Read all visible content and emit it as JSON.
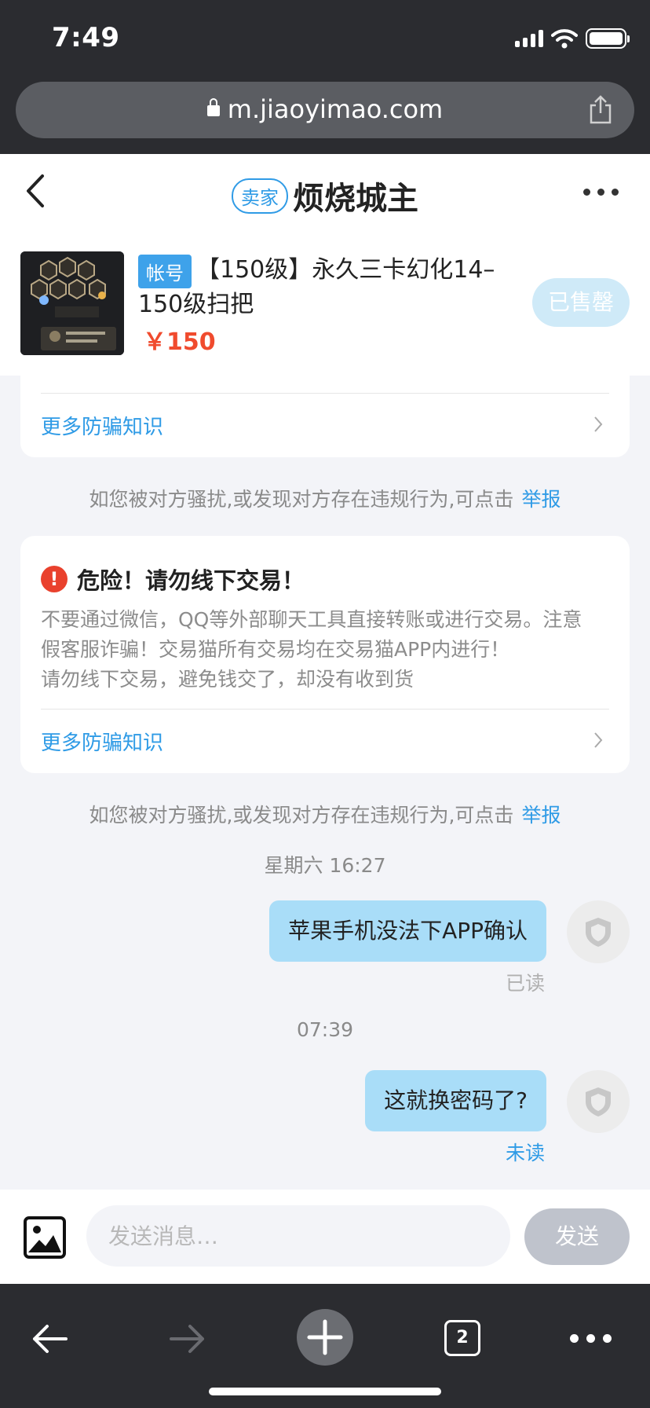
{
  "status": {
    "time": "7:49"
  },
  "browser": {
    "url": "m.jiaoyimao.com",
    "tab_count": "2"
  },
  "header": {
    "seller_badge": "卖家",
    "seller_name": "烦烧城主"
  },
  "product": {
    "tag": "帐号",
    "title": "【150级】永久三卡幻化14–150级扫把",
    "price": "￥150",
    "sold_label": "已售罄"
  },
  "notices": {
    "more_tips_link": "更多防骗知识",
    "report_prefix": "如您被对方骚扰,或发现对方存在违规行为,可点击",
    "report_link": "举报",
    "warning_title": "危险！请勿线下交易！",
    "warning_lines": [
      "不要通过微信，QQ等外部聊天工具直接转账或进行交易。注意",
      "假客服诈骗！交易猫所有交易均在交易猫APP内进行！",
      "请勿线下交易，避免钱交了，却没有收到货"
    ]
  },
  "messages": [
    {
      "time": "星期六 16:27",
      "text": "苹果手机没法下APP确认",
      "state": "已读",
      "state_color": "#b0b0b0"
    },
    {
      "time": "07:39",
      "text": "这就换密码了?",
      "state": "未读",
      "state_color": "#2f9be6"
    }
  ],
  "composer": {
    "placeholder": "发送消息…",
    "send_label": "发送"
  },
  "colors": {
    "accent": "#2f9be6",
    "bubble": "#a9ddf8",
    "price": "#f04b2e",
    "danger": "#e9412d"
  }
}
